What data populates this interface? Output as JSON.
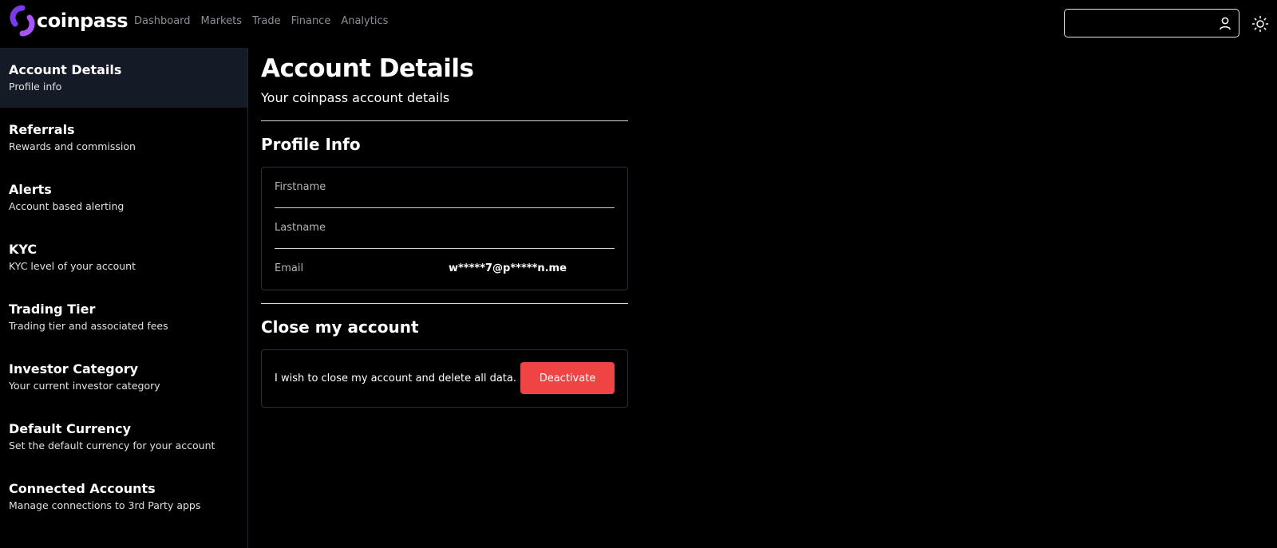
{
  "brand": {
    "name": "coinpass",
    "accent": "#7c3aed"
  },
  "nav": [
    "Dashboard",
    "Markets",
    "Trade",
    "Finance",
    "Analytics"
  ],
  "search": {
    "value": "",
    "placeholder": ""
  },
  "sidebar": {
    "items": [
      {
        "title": "Account Details",
        "subtitle": "Profile info",
        "active": true
      },
      {
        "title": "Referrals",
        "subtitle": "Rewards and commission"
      },
      {
        "title": "Alerts",
        "subtitle": "Account based alerting"
      },
      {
        "title": "KYC",
        "subtitle": "KYC level of your account"
      },
      {
        "title": "Trading Tier",
        "subtitle": "Trading tier and associated fees"
      },
      {
        "title": "Investor Category",
        "subtitle": "Your current investor category"
      },
      {
        "title": "Default Currency",
        "subtitle": "Set the default currency for your account"
      },
      {
        "title": "Connected Accounts",
        "subtitle": "Manage connections to 3rd Party apps"
      }
    ]
  },
  "main": {
    "title": "Account Details",
    "subtitle": "Your coinpass account details",
    "profile": {
      "heading": "Profile Info",
      "firstname_label": "Firstname",
      "lastname_label": "Lastname",
      "email_label": "Email",
      "email_value": "w*****7@p*****n.me"
    },
    "close": {
      "heading": "Close my account",
      "text": "I wish to close my account and delete all data.",
      "button": "Deactivate",
      "button_color": "#ef4444"
    }
  }
}
